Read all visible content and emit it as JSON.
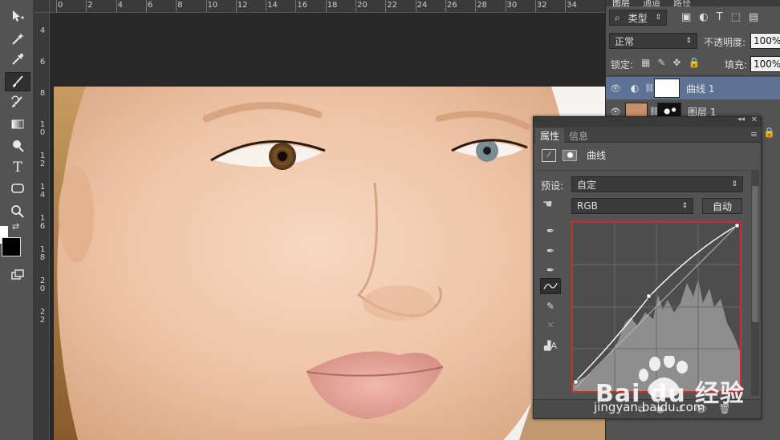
{
  "ruler_top": [
    "0",
    "2",
    "4",
    "6",
    "8",
    "10",
    "12",
    "14",
    "16",
    "18",
    "20",
    "22",
    "24",
    "26",
    "28",
    "30",
    "32",
    "34"
  ],
  "ruler_left": [
    "4",
    "6",
    "8",
    "1\n0",
    "1\n2",
    "1\n4",
    "1\n6",
    "1\n8",
    "2\n0",
    "2\n2"
  ],
  "tools": [
    {
      "name": "move-tool",
      "glyph": "✥"
    },
    {
      "name": "magic-wand-tool",
      "glyph": "✳"
    },
    {
      "name": "eyedropper-tool",
      "glyph": "✎"
    },
    {
      "name": "brush-tool",
      "glyph": "🖌"
    },
    {
      "name": "history-brush-tool",
      "glyph": "✐"
    },
    {
      "name": "gradient-tool",
      "glyph": "▭"
    },
    {
      "name": "dodge-tool",
      "glyph": "●"
    },
    {
      "name": "type-tool",
      "glyph": "T"
    },
    {
      "name": "shape-tool",
      "glyph": "▢"
    },
    {
      "name": "zoom-tool",
      "glyph": "🔍"
    }
  ],
  "layers_panel": {
    "tabs": [
      "图层",
      "通道",
      "路径"
    ],
    "filter_label": "类型",
    "blend_mode": "正常",
    "opacity_label": "不透明度:",
    "opacity_value": "100%",
    "lock_label": "锁定:",
    "fill_label": "填充:",
    "fill_value": "100%",
    "layers": [
      {
        "name": "曲线 1",
        "selected": true
      },
      {
        "name": "图层 1",
        "selected": false
      }
    ]
  },
  "properties_panel": {
    "tabs": [
      "属性",
      "信息"
    ],
    "title": "曲线",
    "preset_label": "预设:",
    "preset_value": "自定",
    "channel_value": "RGB",
    "auto_button": "自动"
  },
  "watermark": {
    "logo": "Bai du 经验",
    "url": "jingyan.baidu.com"
  },
  "colors": {
    "selection_blue": "#5d7294",
    "curve_border_red": "#d9262e"
  }
}
